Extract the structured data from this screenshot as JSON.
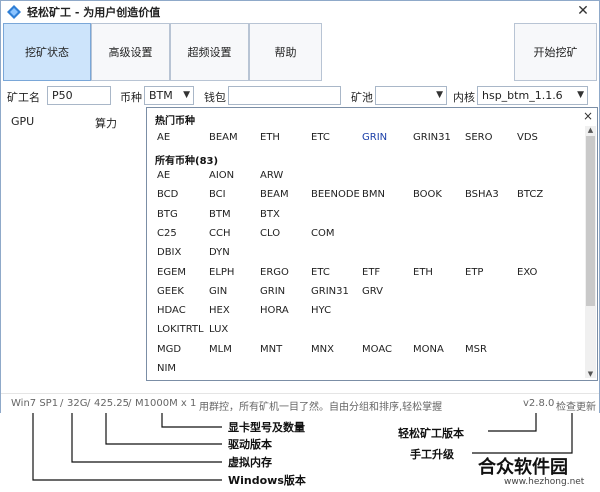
{
  "window": {
    "title": "轻松矿工 - 为用户创造价值",
    "close_glyph": "✕"
  },
  "toolbar": {
    "buttons": [
      "挖矿状态",
      "高级设置",
      "超频设置",
      "帮助"
    ],
    "start_label": "开始挖矿"
  },
  "params": {
    "worker_label": "矿工名",
    "worker_value": "P50",
    "coin_label": "币种",
    "coin_value": "BTM",
    "wallet_label": "钱包",
    "wallet_value": "",
    "pool_label": "矿池",
    "pool_value": "",
    "kernel_label": "内核",
    "kernel_value": "hsp_btm_1.1.6"
  },
  "gpu_table": {
    "col_gpu": "GPU",
    "col_hashrate": "算力"
  },
  "coin_popup": {
    "close_glyph": "×",
    "hot_title": "热门币种",
    "hot_coins": [
      "AE",
      "BEAM",
      "ETH",
      "ETC",
      "GRIN",
      "GRIN31",
      "SERO",
      "VDS"
    ],
    "all_title": "所有币种(83)",
    "all_rows": [
      [
        "AE",
        "AION",
        "ARW"
      ],
      [
        "BCD",
        "BCI",
        "BEAM",
        "BEENODE",
        "BMN",
        "BOOK",
        "BSHA3",
        "BTCZ"
      ],
      [
        "BTG",
        "BTM",
        "BTX"
      ],
      [
        "C25",
        "CCH",
        "CLO",
        "COM"
      ],
      [
        "DBIX",
        "DYN"
      ],
      [
        "EGEM",
        "ELPH",
        "ERGO",
        "ETC",
        "ETF",
        "ETH",
        "ETP",
        "EXO"
      ],
      [
        "GEEK",
        "GIN",
        "GRIN",
        "GRIN31",
        "GRV"
      ],
      [
        "HDAC",
        "HEX",
        "HORA",
        "HYC"
      ],
      [
        "LOKITRTL",
        "LUX"
      ],
      [
        "MGD",
        "MLM",
        "MNT",
        "MNX",
        "MOAC",
        "MONA",
        "MSR"
      ],
      [
        "NIM"
      ]
    ]
  },
  "status": {
    "os": "Win7 SP1",
    "memory": "32G",
    "driver": "425.25",
    "gpu": "M1000M x 1",
    "tip": "用群控，所有矿机一目了然。自由分组和排序,轻松掌握",
    "version": "v2.8.0",
    "check_update": "检查更新"
  },
  "annotations": {
    "gpu_model": "显卡型号及数量",
    "driver_version": "驱动版本",
    "virtual_memory": "虚拟内存",
    "windows_version": "Windows版本",
    "app_version": "轻松矿工版本",
    "manual_upgrade": "手工升级"
  },
  "brand": {
    "name": "合众软件园",
    "url": "www.hezhong.net"
  }
}
